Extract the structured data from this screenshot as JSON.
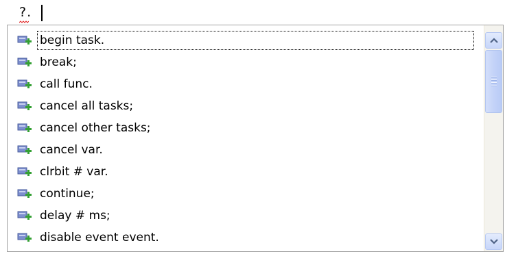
{
  "editor": {
    "text": "?."
  },
  "completion": {
    "items": [
      {
        "label": "begin task.",
        "icon": "insert-snippet-icon"
      },
      {
        "label": "break;",
        "icon": "insert-snippet-icon"
      },
      {
        "label": "call func.",
        "icon": "insert-snippet-icon"
      },
      {
        "label": "cancel all tasks;",
        "icon": "insert-snippet-icon"
      },
      {
        "label": "cancel other tasks;",
        "icon": "insert-snippet-icon"
      },
      {
        "label": "cancel var.",
        "icon": "insert-snippet-icon"
      },
      {
        "label": "clrbit # var.",
        "icon": "insert-snippet-icon"
      },
      {
        "label": "continue;",
        "icon": "insert-snippet-icon"
      },
      {
        "label": "delay # ms;",
        "icon": "insert-snippet-icon"
      },
      {
        "label": "disable event event.",
        "icon": "insert-snippet-icon"
      }
    ],
    "selected_index": 0
  },
  "colors": {
    "scroll_accent": "#c4d3f8",
    "icon_blue": "#5a72b8",
    "icon_green": "#3aa13a"
  }
}
